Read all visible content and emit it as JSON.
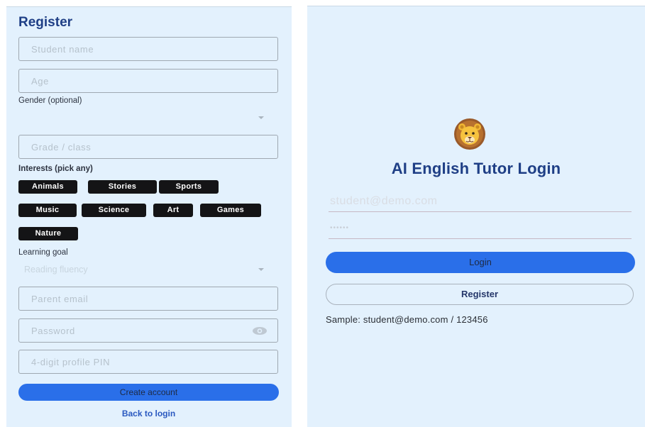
{
  "register": {
    "title": "Register",
    "student_name_placeholder": "Student name",
    "age_placeholder": "Age",
    "gender_label": "Gender (optional)",
    "gender_value": "",
    "grade_placeholder": "Grade / class",
    "interests_label": "Interests (pick any)",
    "interests": [
      "Animals",
      "Stories",
      "Sports",
      "Music",
      "Science",
      "Art",
      "Games",
      "Nature"
    ],
    "goal_label": "Learning goal",
    "goal_value": "Reading fluency",
    "parent_email_placeholder": "Parent email",
    "password_placeholder": "Password",
    "pin_placeholder": "4-digit profile PIN",
    "create_button": "Create account",
    "back_link": "Back to login"
  },
  "login": {
    "logo_icon": "lion-icon",
    "title": "AI English Tutor Login",
    "email_placeholder": "student@demo.com",
    "password_placeholder": "••••••",
    "login_button": "Login",
    "register_button": "Register",
    "sample_text": "Sample: student@demo.com / 123456"
  },
  "colors": {
    "panel_bg": "#e3f1fd",
    "accent": "#2a6fe9",
    "title": "#1f3f86",
    "chip_bg": "#141416"
  }
}
